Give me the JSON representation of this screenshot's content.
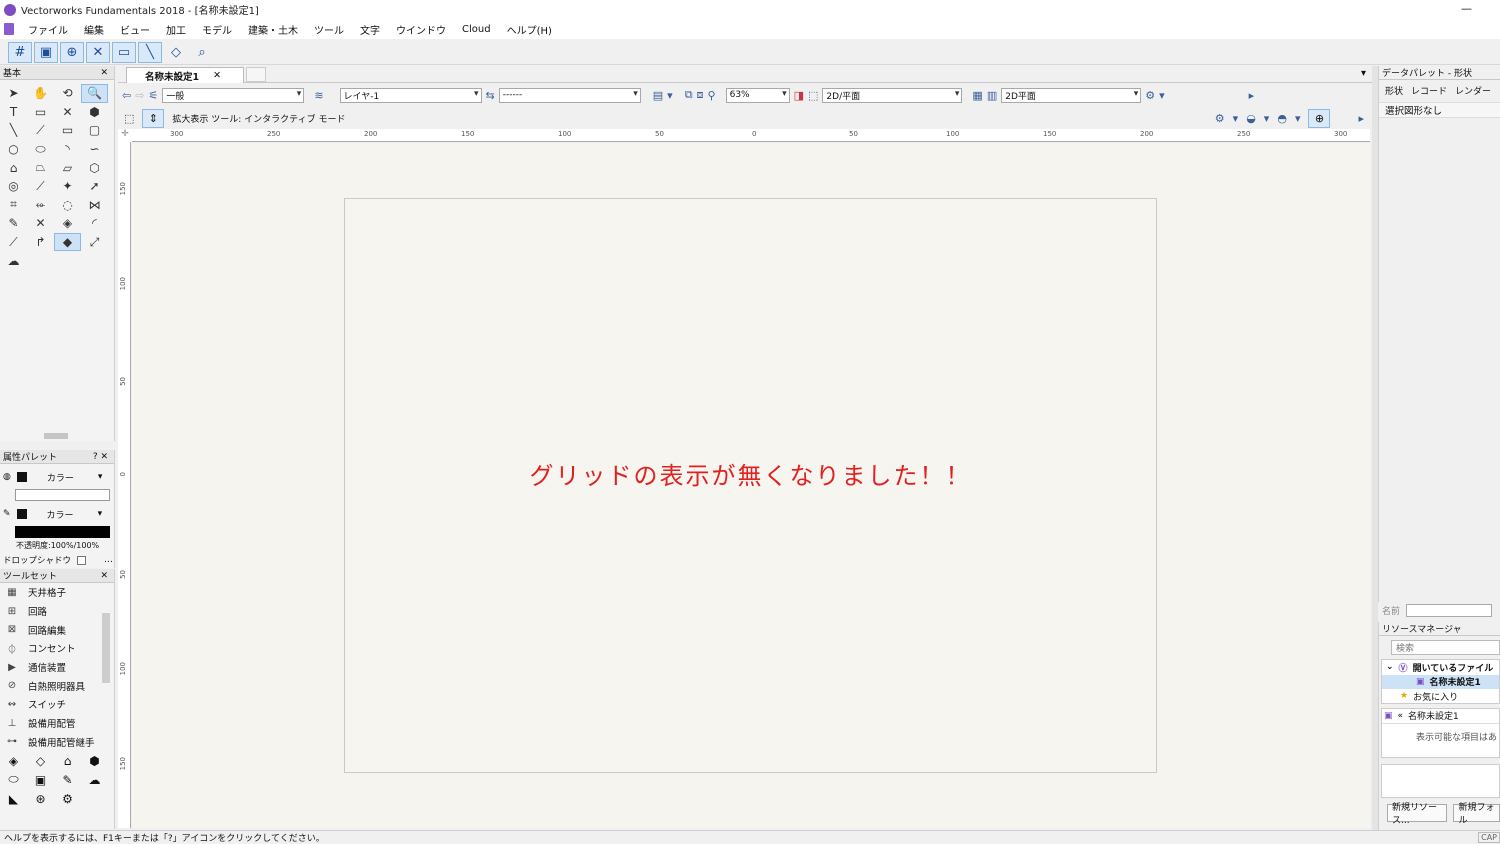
{
  "window": {
    "title": "Vectorworks Fundamentals 2018 - [名称未設定1]",
    "minimize": "—"
  },
  "menu": [
    "ファイル",
    "編集",
    "ビュー",
    "加工",
    "モデル",
    "建築・土木",
    "ツール",
    "文字",
    "ウインドウ",
    "Cloud",
    "ヘルプ(H)"
  ],
  "palettes": {
    "basic_title": "基本",
    "attr_title": "属性パレット",
    "attr_help": "?",
    "fill_label": "カラー",
    "pen_label": "カラー",
    "opacity": "不透明度:100%/100%",
    "dropshadow": "ドロップシャドウ",
    "toolset_title": "ツールセット",
    "toolset_items": [
      "天井格子",
      "回路",
      "回路編集",
      "コンセント",
      "通信装置",
      "白熱照明器具",
      "スイッチ",
      "設備用配管",
      "設備用配管継手"
    ]
  },
  "doc": {
    "tab_label": "名称未設定1",
    "class_value": "一般",
    "layer_value": "レイヤ-1",
    "line_value": "------",
    "zoom": "63%",
    "view_value": "2D/平面",
    "render_value": "2D平面",
    "mode_text": "拡大表示 ツール: インタラクティブ モード",
    "ruler_top": [
      "300",
      "250",
      "200",
      "150",
      "100",
      "50",
      "0",
      "50",
      "100",
      "150",
      "200",
      "250",
      "300"
    ],
    "ruler_left": [
      "150",
      "100",
      "50",
      "0",
      "50",
      "100",
      "150"
    ]
  },
  "canvas_message": "グリッドの表示が無くなりました！！",
  "data_palette": {
    "title": "データパレット - 形状",
    "tabs": [
      "形状",
      "レコード",
      "レンダー"
    ],
    "selection": "選択図形なし",
    "name_label": "名前"
  },
  "resource_manager": {
    "title": "リソースマネージャ",
    "search_placeholder": "検索",
    "open_files": "開いているファイル",
    "file_name": "名称未設定1",
    "favorites": "お気に入り",
    "current_file": "名称未設定1",
    "empty_text": "表示可能な項目はあ",
    "new_resource": "新規リソース...",
    "new_folder": "新規フォル"
  },
  "status": {
    "help": "ヘルプを表示するには、F1キーまたは「?」アイコンをクリックしてください。",
    "cap": "CAP"
  },
  "colors": {
    "message": "#e12020",
    "canvas": "#f5f4ee",
    "accent": "#7b4fc0"
  }
}
